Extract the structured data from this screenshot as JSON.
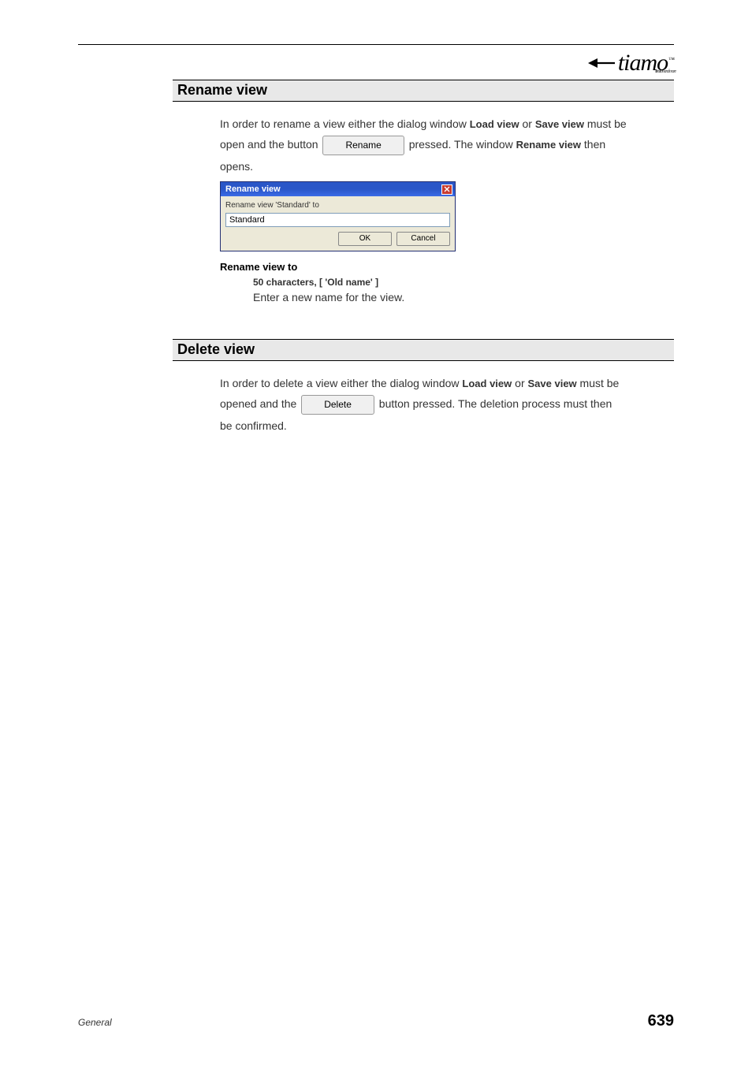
{
  "logo": {
    "brand": "tiamo",
    "trademark": "™",
    "sub": "titration and more"
  },
  "sections": {
    "rename": {
      "heading": "Rename view",
      "para1_pre": "In order to rename a view either the dialog window ",
      "para1_b1": "Load view",
      "para1_mid": " or ",
      "para1_b2": "Save view",
      "para1_post": " must be",
      "para2_pre": "open and the button ",
      "rename_btn": "Rename",
      "para2_mid": " pressed. The window ",
      "para2_b1": "Rename view",
      "para2_post": " then",
      "para3": "opens.",
      "dialog": {
        "title": "Rename view",
        "label": "Rename view 'Standard' to",
        "input_value": "Standard",
        "ok": "OK",
        "cancel": "Cancel"
      },
      "def_term": "Rename view to",
      "def_constraint": "50 characters, [ 'Old name' ]",
      "def_desc": "Enter a new name for the view."
    },
    "delete": {
      "heading": "Delete view",
      "para1_pre": "In order to delete a view either the dialog window ",
      "para1_b1": "Load view",
      "para1_mid": " or ",
      "para1_b2": "Save view",
      "para1_post": " must be",
      "para2_pre": "opened and the ",
      "delete_btn": "Delete",
      "para2_post": " button pressed. The deletion process must then",
      "para3": "be confirmed."
    }
  },
  "footer": {
    "left": "General",
    "page": "639"
  }
}
